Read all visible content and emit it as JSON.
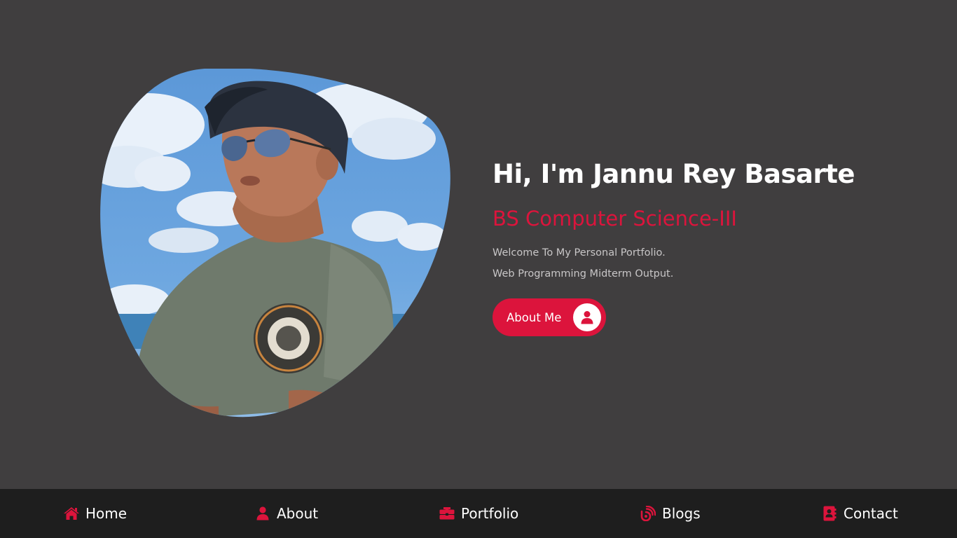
{
  "hero": {
    "greeting": "Hi, I'm Jannu Rey Basarte",
    "subtitle": "BS Computer Science-III",
    "line1": "Welcome To My Personal Portfolio.",
    "line2": "Web Programming Midterm Output.",
    "button_label": "About Me",
    "button_icon": "user-icon",
    "accent_color": "#dc143c"
  },
  "nav": {
    "items": [
      {
        "label": "Home",
        "icon": "home-icon"
      },
      {
        "label": "About",
        "icon": "user-icon"
      },
      {
        "label": "Portfolio",
        "icon": "briefcase-icon"
      },
      {
        "label": "Blogs",
        "icon": "blog-icon"
      },
      {
        "label": "Contact",
        "icon": "address-book-icon"
      }
    ],
    "background": "#1e1e1e"
  },
  "colors": {
    "page_background": "#403e3f",
    "heading": "#ffffff",
    "body_text": "#c8c6c7"
  }
}
